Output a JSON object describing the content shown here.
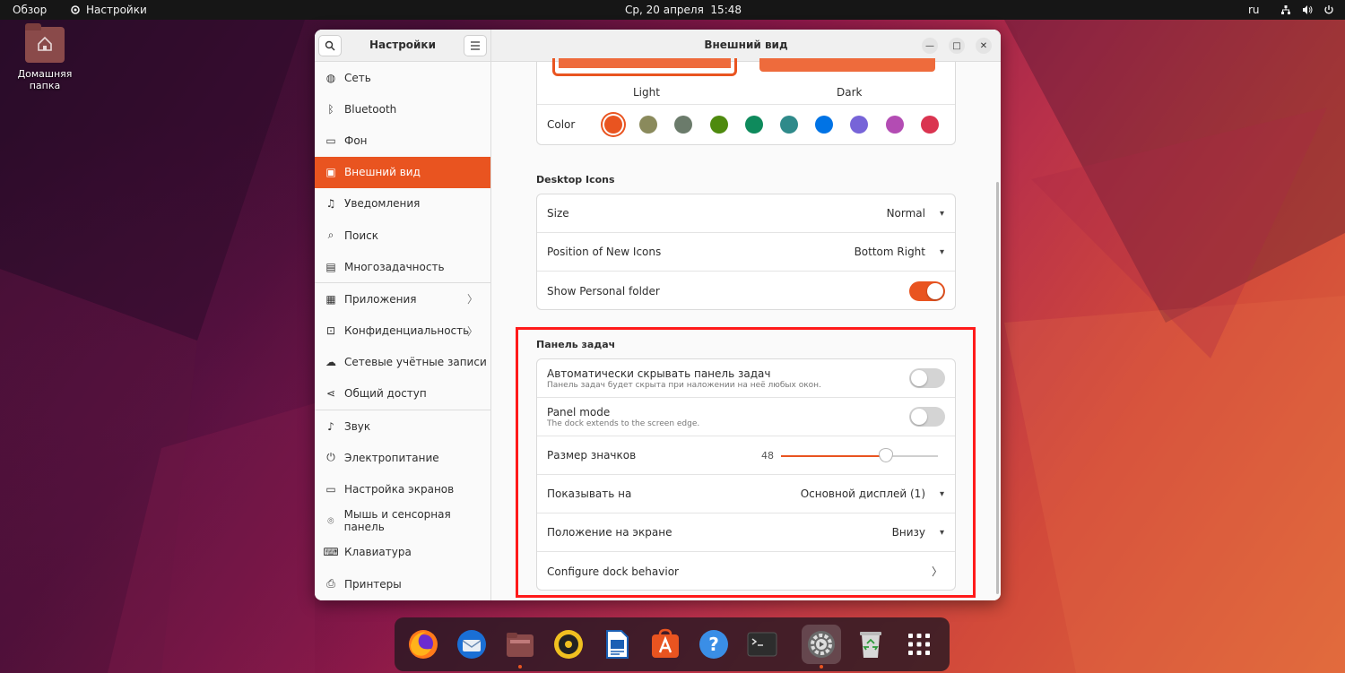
{
  "topbar": {
    "overview": "Обзор",
    "app_name": "Настройки",
    "clock": "Ср, 20 апреля  15:48",
    "lang": "ru"
  },
  "desktop": {
    "home_label": "Домашняя папка"
  },
  "sidebar": {
    "title": "Настройки",
    "items": [
      {
        "label": "Сеть",
        "icon": "globe-icon"
      },
      {
        "label": "Bluetooth",
        "icon": "bluetooth-icon"
      },
      {
        "label": "Фон",
        "icon": "background-icon"
      },
      {
        "label": "Внешний вид",
        "icon": "appearance-icon"
      },
      {
        "label": "Уведомления",
        "icon": "bell-icon"
      },
      {
        "label": "Поиск",
        "icon": "search-icon"
      },
      {
        "label": "Многозадачность",
        "icon": "multitasking-icon"
      },
      {
        "label": "Приложения",
        "icon": "apps-icon"
      },
      {
        "label": "Конфиденциальность",
        "icon": "lock-icon"
      },
      {
        "label": "Сетевые учётные записи",
        "icon": "cloud-icon"
      },
      {
        "label": "Общий доступ",
        "icon": "share-icon"
      },
      {
        "label": "Звук",
        "icon": "music-icon"
      },
      {
        "label": "Электропитание",
        "icon": "power-icon"
      },
      {
        "label": "Настройка экранов",
        "icon": "display-icon"
      },
      {
        "label": "Мышь и сенсорная панель",
        "icon": "mouse-icon"
      },
      {
        "label": "Клавиатура",
        "icon": "keyboard-icon"
      },
      {
        "label": "Принтеры",
        "icon": "printer-icon"
      }
    ]
  },
  "main": {
    "title": "Внешний вид",
    "style": {
      "light": "Light",
      "dark": "Dark"
    },
    "color": {
      "label": "Color",
      "swatches": [
        "#e95420",
        "#8a8a5c",
        "#6b7b6b",
        "#4e8a0e",
        "#0e8a5c",
        "#2f8a8a",
        "#0073e5",
        "#7764d8",
        "#b34cb3",
        "#da3450"
      ],
      "selected_index": 0
    },
    "desktop_icons": {
      "title": "Desktop Icons",
      "size_label": "Size",
      "size_value": "Normal",
      "position_label": "Position of New Icons",
      "position_value": "Bottom Right",
      "personal_label": "Show Personal folder",
      "personal_on": true
    },
    "dock": {
      "title": "Панель задач",
      "autohide_label": "Автоматически скрывать панель задач",
      "autohide_sub": "Панель задач будет скрыта при наложении на неё любых окон.",
      "autohide_on": false,
      "panel_label": "Panel mode",
      "panel_sub": "The dock extends to the screen edge.",
      "panel_on": false,
      "icon_size_label": "Размер значков",
      "icon_size_value": "48",
      "icon_size_fraction": 0.67,
      "show_on_label": "Показывать на",
      "show_on_value": "Основной дисплей (1)",
      "position_label": "Положение на экране",
      "position_value": "Внизу",
      "configure_label": "Configure dock behavior"
    }
  },
  "dock_apps": [
    "firefox-icon",
    "thunderbird-icon",
    "files-icon",
    "rhythmbox-icon",
    "writer-icon",
    "software-icon",
    "help-icon",
    "terminal-icon",
    "settings-icon",
    "trash-icon",
    "app-grid-icon"
  ],
  "colors": {
    "accent": "#e95420"
  }
}
